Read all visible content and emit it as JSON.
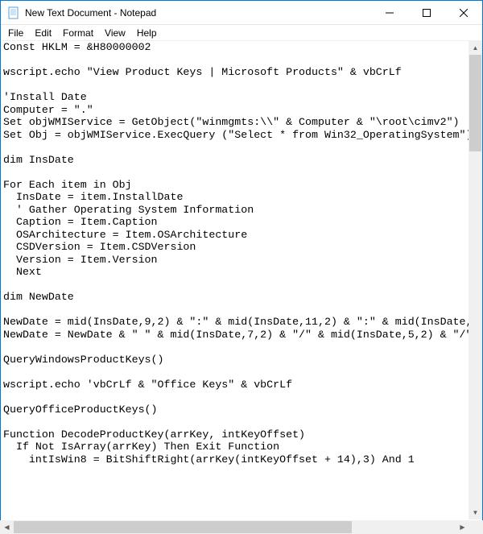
{
  "titlebar": {
    "title": "New Text Document - Notepad"
  },
  "menubar": {
    "items": [
      {
        "label": "File"
      },
      {
        "label": "Edit"
      },
      {
        "label": "Format"
      },
      {
        "label": "View"
      },
      {
        "label": "Help"
      }
    ]
  },
  "editor": {
    "text": "Const HKLM = &H80000002\n\nwscript.echo \"View Product Keys | Microsoft Products\" & vbCrLf\n\n'Install Date\nComputer = \".\"\nSet objWMIService = GetObject(\"winmgmts:\\\\\" & Computer & \"\\root\\cimv2\")\nSet Obj = objWMIService.ExecQuery (\"Select * from Win32_OperatingSystem\")\n\ndim InsDate\n\nFor Each item in Obj\n  InsDate = item.InstallDate\n  ' Gather Operating System Information\n  Caption = Item.Caption\n  OSArchitecture = Item.OSArchitecture\n  CSDVersion = Item.CSDVersion\n  Version = Item.Version\n  Next\n\ndim NewDate\n\nNewDate = mid(InsDate,9,2) & \":\" & mid(InsDate,11,2) & \":\" & mid(InsDate,\nNewDate = NewDate & \" \" & mid(InsDate,7,2) & \"/\" & mid(InsDate,5,2) & \"/\"\n\nQueryWindowsProductKeys()\n\nwscript.echo 'vbCrLf & \"Office Keys\" & vbCrLf\n\nQueryOfficeProductKeys()\n\nFunction DecodeProductKey(arrKey, intKeyOffset)\n  If Not IsArray(arrKey) Then Exit Function\n    intIsWin8 = BitShiftRight(arrKey(intKeyOffset + 14),3) And 1"
  }
}
